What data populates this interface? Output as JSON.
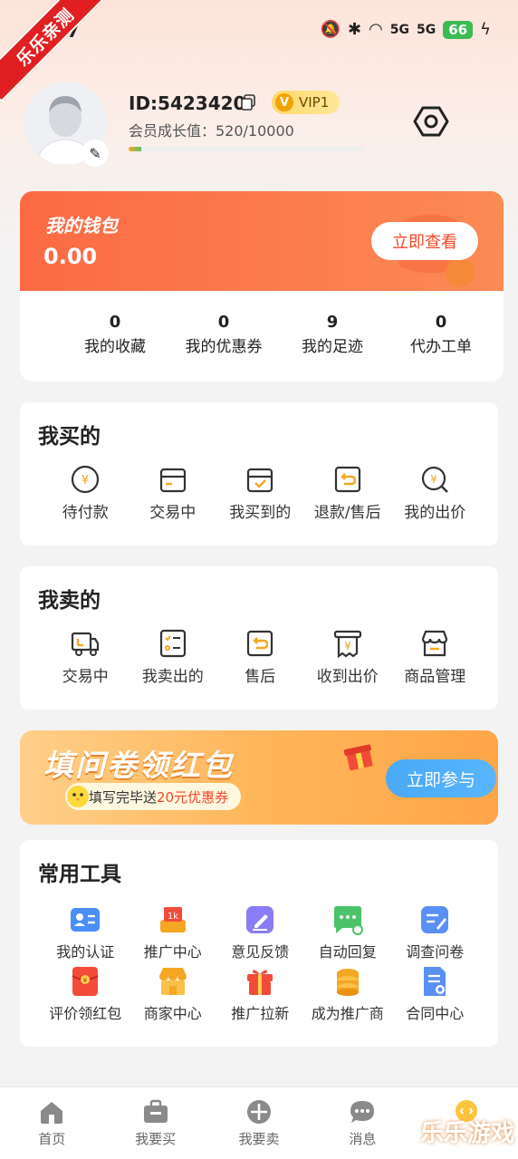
{
  "status_bar": {
    "time": "17",
    "sig1": "5G",
    "sig2": "5G",
    "battery": "66"
  },
  "ribbon_text": "乐乐亲测",
  "profile": {
    "user_id": "ID:5423420",
    "vip_letter": "V",
    "vip_label": "VIP1",
    "growth_text": "会员成长值：520/10000",
    "growth_progress": 0.052
  },
  "wallet": {
    "title": "我的钱包",
    "amount": "0.00",
    "view_button": "立即查看",
    "stats": [
      {
        "num": "0",
        "label": "我的收藏"
      },
      {
        "num": "0",
        "label": "我的优惠券"
      },
      {
        "num": "9",
        "label": "我的足迹"
      },
      {
        "num": "0",
        "label": "代办工单"
      }
    ]
  },
  "buy_section": {
    "title": "我买的",
    "items": [
      {
        "label": "待付款",
        "icon": "yuan-circle-icon"
      },
      {
        "label": "交易中",
        "icon": "box-icon"
      },
      {
        "label": "我买到的",
        "icon": "box-check-icon"
      },
      {
        "label": "退款/售后",
        "icon": "return-icon"
      },
      {
        "label": "我的出价",
        "icon": "bid-search-icon"
      }
    ]
  },
  "sell_section": {
    "title": "我卖的",
    "items": [
      {
        "label": "交易中",
        "icon": "truck-icon"
      },
      {
        "label": "我卖出的",
        "icon": "checklist-icon"
      },
      {
        "label": "售后",
        "icon": "return-icon"
      },
      {
        "label": "收到出价",
        "icon": "receipt-icon"
      },
      {
        "label": "商品管理",
        "icon": "store-icon"
      }
    ]
  },
  "banner": {
    "title": "填问卷领红包",
    "sub_prefix": "填写完毕送",
    "sub_highlight": "20元优惠券",
    "button": "立即参与"
  },
  "tools_section": {
    "title": "常用工具",
    "items": [
      {
        "label": "我的认证",
        "icon": "id-card-icon",
        "color": "#4a8ff7"
      },
      {
        "label": "推广中心",
        "icon": "promo-icon",
        "color": "#f5a623"
      },
      {
        "label": "意见反馈",
        "icon": "feedback-icon",
        "color": "#8a7cf5"
      },
      {
        "label": "自动回复",
        "icon": "auto-reply-icon",
        "color": "#4cc36a"
      },
      {
        "label": "调查问卷",
        "icon": "survey-icon",
        "color": "#5a8ff5"
      },
      {
        "label": "评价领红包",
        "icon": "red-packet-icon",
        "color": "#f24b3a"
      },
      {
        "label": "商家中心",
        "icon": "merchant-icon",
        "color": "#f5a623"
      },
      {
        "label": "推广拉新",
        "icon": "gift-box-icon",
        "color": "#f24b3a"
      },
      {
        "label": "成为推广商",
        "icon": "coins-icon",
        "color": "#f5a623"
      },
      {
        "label": "合同中心",
        "icon": "contract-icon",
        "color": "#5a8ff5"
      }
    ]
  },
  "bottom_nav": [
    {
      "label": "首页",
      "icon": "home-icon"
    },
    {
      "label": "我要买",
      "icon": "briefcase-icon"
    },
    {
      "label": "我要卖",
      "icon": "sell-plus-icon"
    },
    {
      "label": "消息",
      "icon": "message-icon"
    },
    {
      "label": "",
      "icon": "mine-icon"
    }
  ],
  "watermark": "乐乐游戏"
}
